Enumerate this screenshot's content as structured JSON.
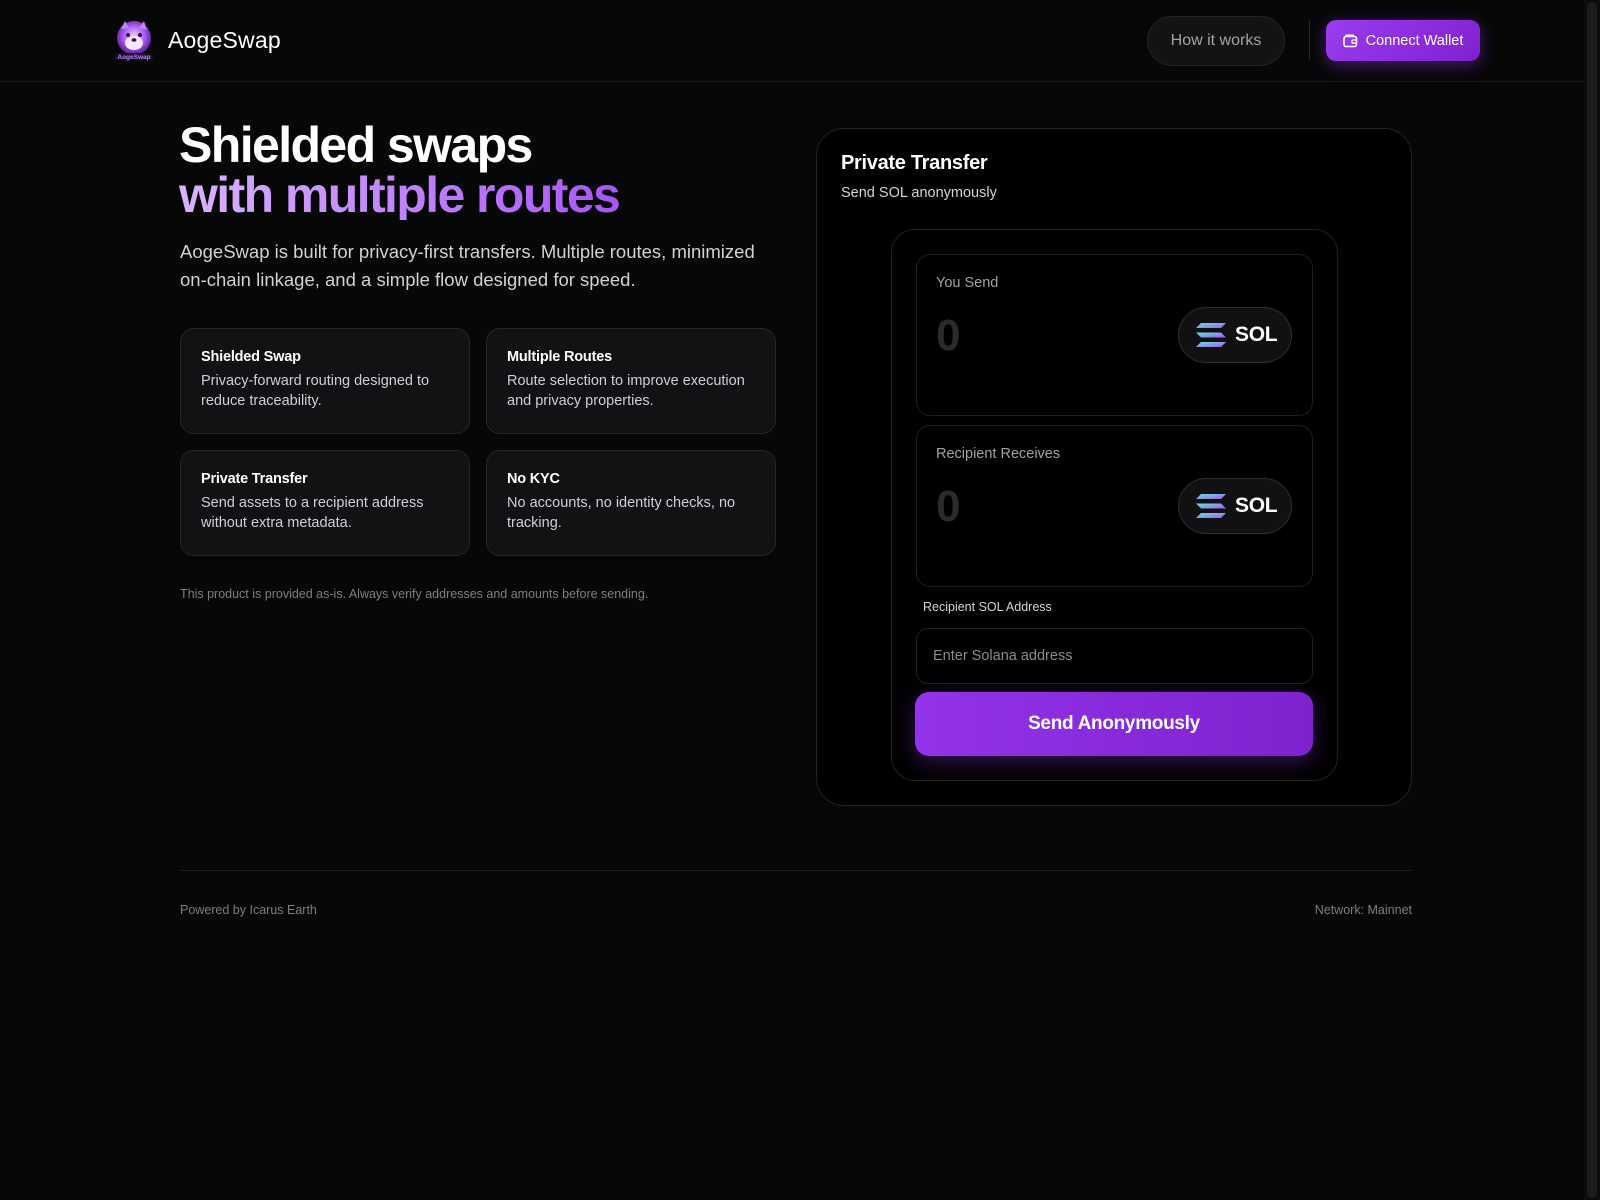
{
  "header": {
    "brand": "AogeSwap",
    "logo_caption": "AogeSwap",
    "how_it_works": "How it works",
    "connect_wallet": "Connect Wallet"
  },
  "hero": {
    "title_line1": "Shielded swaps",
    "title_line2": "with multiple routes",
    "description": "AogeSwap is built for privacy-first transfers. Multiple routes, minimized on-chain linkage, and a simple flow designed for speed."
  },
  "features": [
    {
      "title": "Shielded Swap",
      "desc": "Privacy-forward routing designed to reduce traceability."
    },
    {
      "title": "Multiple Routes",
      "desc": "Route selection to improve execution and privacy properties."
    },
    {
      "title": "Private Transfer",
      "desc": "Send assets to a recipient address without extra metadata."
    },
    {
      "title": "No KYC",
      "desc": "No accounts, no identity checks, no tracking."
    }
  ],
  "disclaimer": "This product is provided as-is. Always verify addresses and amounts before sending.",
  "panel": {
    "title": "Private Transfer",
    "subtitle": "Send SOL anonymously",
    "send": {
      "label": "You Send",
      "amount": "0",
      "token": "SOL"
    },
    "receive": {
      "label": "Recipient Receives",
      "amount": "0",
      "token": "SOL"
    },
    "address_label": "Recipient SOL Address",
    "address_placeholder": "Enter Solana address",
    "submit": "Send Anonymously"
  },
  "footer": {
    "powered_by": "Powered by Icarus Earth",
    "network": "Network: Mainnet"
  },
  "colors": {
    "accent": "#9333ea",
    "accent_light": "#c084fc",
    "background": "#070707"
  },
  "icons": {
    "logo": "doge-logo-icon",
    "wallet": "wallet-icon",
    "token": "solana-icon"
  }
}
